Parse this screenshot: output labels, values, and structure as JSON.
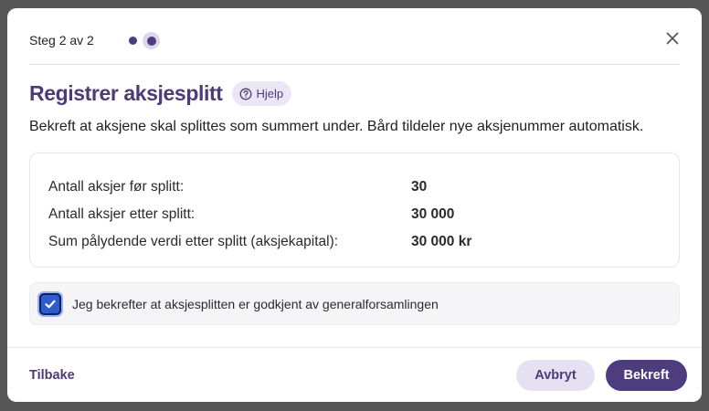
{
  "dialog": {
    "step_label": "Steg 2 av 2",
    "title": "Registrer aksjesplitt",
    "help_label": "Hjelp",
    "description": "Bekreft at aksjene skal splittes som summert under. Bård tildeler nye aksjenummer automatisk.",
    "summary": [
      {
        "label": "Antall aksjer før splitt:",
        "value": "30"
      },
      {
        "label": "Antall aksjer etter splitt:",
        "value": "30 000"
      },
      {
        "label": "Sum pålydende verdi etter splitt (aksjekapital):",
        "value": "30 000 kr"
      }
    ],
    "confirm_label": "Jeg bekrefter at aksjesplitten er godkjent av generalforsamlingen",
    "confirm_checked": true
  },
  "footer": {
    "back_label": "Tilbake",
    "cancel_label": "Avbryt",
    "confirm_label": "Bekreft"
  },
  "icons": {
    "close": "close-icon",
    "help": "question-circle-icon",
    "check": "check-icon"
  },
  "colors": {
    "brand": "#4d3d7f",
    "brand_light": "#e6e1f2",
    "checkbox": "#2f5ccc"
  }
}
